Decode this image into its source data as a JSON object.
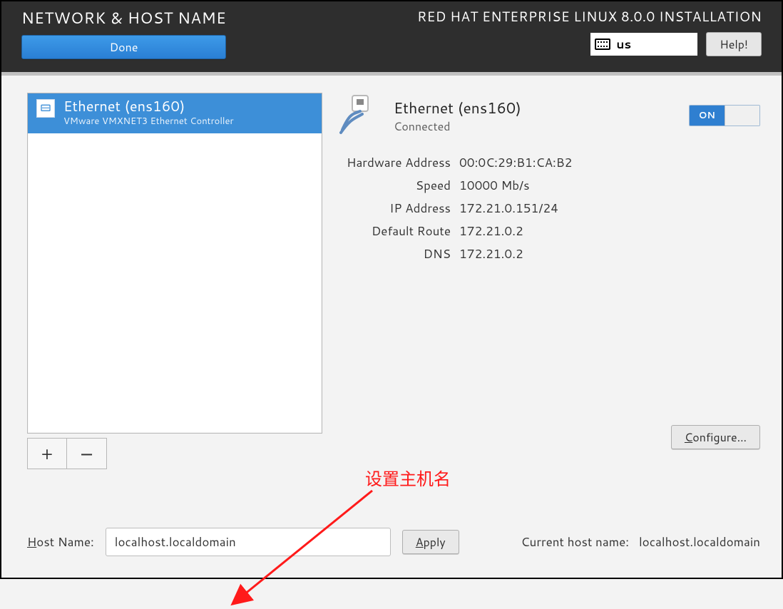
{
  "header": {
    "screen_title": "NETWORK & HOST NAME",
    "product_title": "RED HAT ENTERPRISE LINUX 8.0.0 INSTALLATION",
    "done_label": "Done",
    "help_label": "Help!",
    "keyboard_layout": "us"
  },
  "device_list": {
    "items": [
      {
        "name": "Ethernet (ens160)",
        "subtitle": "VMware VMXNET3 Ethernet Controller"
      }
    ],
    "add_label": "+",
    "remove_label": "−"
  },
  "details": {
    "name": "Ethernet (ens160)",
    "status": "Connected",
    "switch_on_label": "ON",
    "rows": {
      "hw_label": "Hardware Address",
      "hw_value": "00:0C:29:B1:CA:B2",
      "speed_label": "Speed",
      "speed_value": "10000 Mb/s",
      "ip_label": "IP Address",
      "ip_value": "172.21.0.151/24",
      "route_label": "Default Route",
      "route_value": "172.21.0.2",
      "dns_label": "DNS",
      "dns_value": "172.21.0.2"
    },
    "configure_label": "Configure..."
  },
  "hostname": {
    "label_prefix": "H",
    "label_rest": "ost Name:",
    "value": "localhost.localdomain",
    "apply_label": "Apply",
    "current_label": "Current host name:",
    "current_value": "localhost.localdomain"
  },
  "annotation": {
    "text": "设置主机名"
  }
}
